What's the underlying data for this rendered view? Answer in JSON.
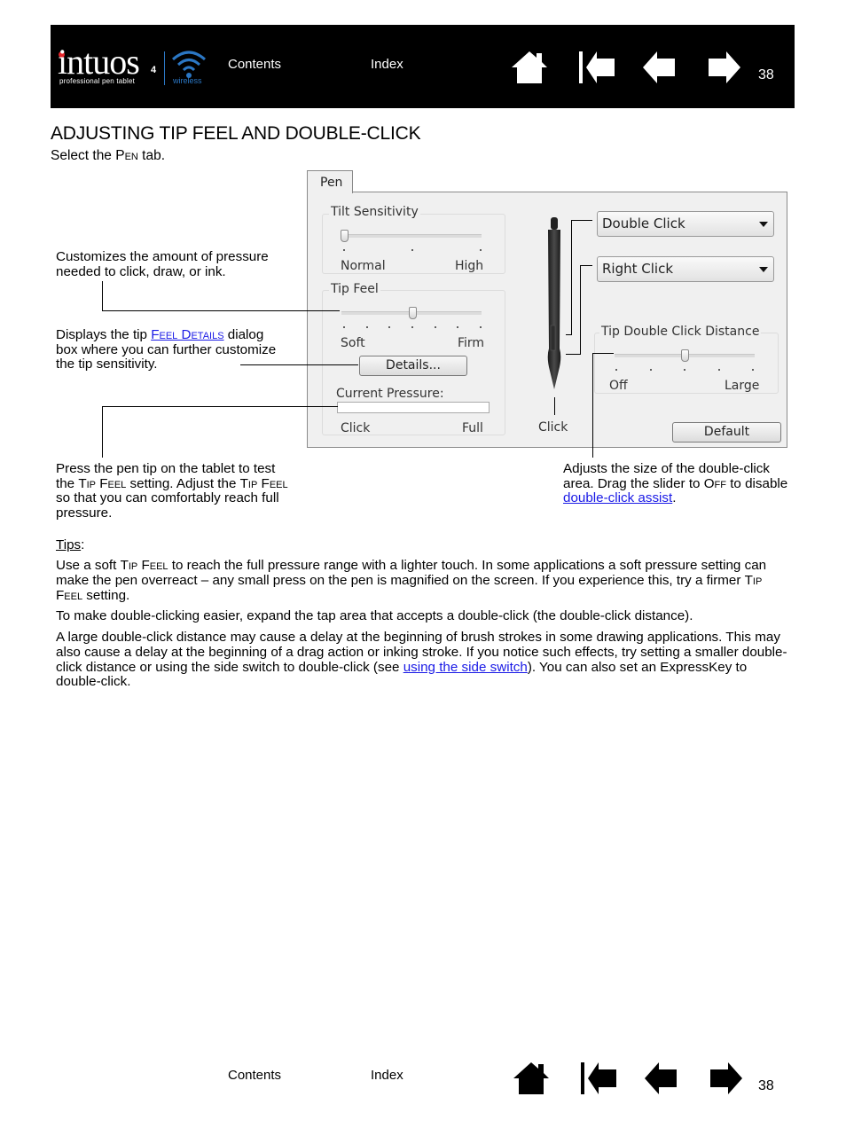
{
  "header": {
    "logo": {
      "word": "intuos",
      "model": "4",
      "tagline": "professional pen tablet",
      "wireless": "wireless",
      "brand_red": "#e3262b",
      "wireless_blue": "#2b77c4"
    },
    "nav": {
      "contents": "Contents",
      "index": "Index"
    },
    "icons": [
      "home-icon",
      "first-page-icon",
      "previous-page-icon",
      "next-page-icon"
    ],
    "page_number": "38"
  },
  "title": "ADJUSTING TIP FEEL AND DOUBLE-CLICK",
  "subtitle": {
    "before": "Select the ",
    "smallcaps": "Pen",
    "after": " tab."
  },
  "dialog": {
    "tab_label": "Pen",
    "tilt": {
      "label": "Tilt Sensitivity",
      "min_label": "Normal",
      "max_label": "High",
      "ticks": 3,
      "value_fraction": 0.0
    },
    "tip_feel": {
      "label": "Tip Feel",
      "min_label": "Soft",
      "max_label": "Firm",
      "ticks": 7,
      "value_fraction": 0.5,
      "details_button": "Details..."
    },
    "pressure": {
      "label": "Current Pressure:",
      "min_label": "Click",
      "max_label": "Full",
      "value_fraction": 0.0
    },
    "upper_switch": "Double Click",
    "lower_switch": "Right Click",
    "tip_label": "Click",
    "double_click": {
      "label": "Tip Double Click Distance",
      "min_label": "Off",
      "max_label": "Large",
      "ticks": 5,
      "value_fraction": 0.5
    },
    "default_button": "Default"
  },
  "callouts": {
    "pressure_amount": "Customizes the amount of pressure needed to click, draw, or ink.",
    "details": {
      "before": "Displays the tip ",
      "link": "Feel Details",
      "after": " dialog box where you can further customize the tip sensitivity."
    },
    "test": {
      "p1": "Press the pen tip on the tablet to test the ",
      "sc1": "Tip Feel",
      "p2": " setting.  Adjust the ",
      "sc2": "Tip Feel",
      "p3": " so that you can comfortably reach full pressure."
    },
    "double_click": {
      "p1": "Adjusts the size of the double-click area.  Drag the slider to ",
      "sc1": "Off",
      "p2": " to disable ",
      "link": "double-click assist",
      "p3": "."
    }
  },
  "tips": {
    "heading": "Tips",
    "para1": {
      "p1": "Use a soft ",
      "sc1": "Tip Feel",
      "p2": " to reach the full pressure range with a lighter touch.  In some applications a soft pressure setting can make the pen overreact – any small press on the pen is magnified on the screen.  If you experience this, try a firmer ",
      "sc2": "Tip Feel",
      "p3": " setting."
    },
    "para2": "To make double-clicking easier, expand the tap area that accepts a double-click (the double-click distance).",
    "para3": {
      "p1": "A large double-click distance may cause a delay at the beginning of brush strokes in some drawing applications. This may also cause a delay at the beginning of a drag action or inking stroke.  If you notice such effects, try setting a smaller double-click distance or using the side switch to double-click (see ",
      "link": "using the side switch",
      "p2": ").  You can also set an ExpressKey to double-click."
    }
  },
  "footer": {
    "nav": {
      "contents": "Contents",
      "index": "Index"
    },
    "page_number": "38"
  }
}
